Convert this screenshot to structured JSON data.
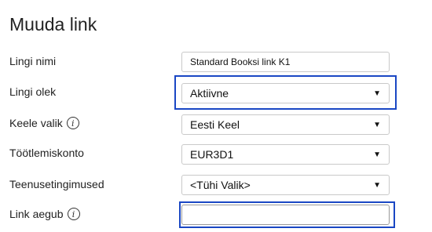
{
  "page": {
    "title": "Muuda link"
  },
  "form": {
    "link_name": {
      "label": "Lingi nimi",
      "value": "Standard Booksi link K1"
    },
    "link_status": {
      "label": "Lingi olek",
      "value": "Aktiivne"
    },
    "language": {
      "label": "Keele valik",
      "value": "Eesti Keel",
      "info_icon": "info-icon"
    },
    "account": {
      "label": "Töötlemiskonto",
      "value": "EUR3D1"
    },
    "terms": {
      "label": "Teenusetingimused",
      "value": "<Tühi Valik>"
    },
    "expires": {
      "label": "Link aegub",
      "value": "",
      "info_icon": "info-icon"
    }
  },
  "icons": {
    "dropdown_arrow": "▼",
    "info": "i"
  },
  "colors": {
    "focus_border": "#1a47c4",
    "field_border": "#c9c9c9"
  }
}
